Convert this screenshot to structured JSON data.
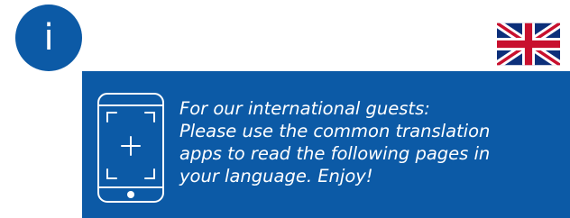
{
  "info_badge": {
    "letter": "i",
    "icon": "info-icon"
  },
  "flag": {
    "icon": "uk-flag-icon",
    "colors": {
      "blue": "#0c2f7a",
      "red": "#c8102e",
      "white": "#ffffff"
    }
  },
  "phone": {
    "icon": "smartphone-scan-icon"
  },
  "message": {
    "lines": [
      "For our international guests:",
      "Please use the common translation",
      "apps to read the following pages in",
      "your language. Enjoy!"
    ]
  },
  "colors": {
    "panel": "#0c5aa6",
    "text": "#ffffff",
    "background": "#ffffff"
  }
}
